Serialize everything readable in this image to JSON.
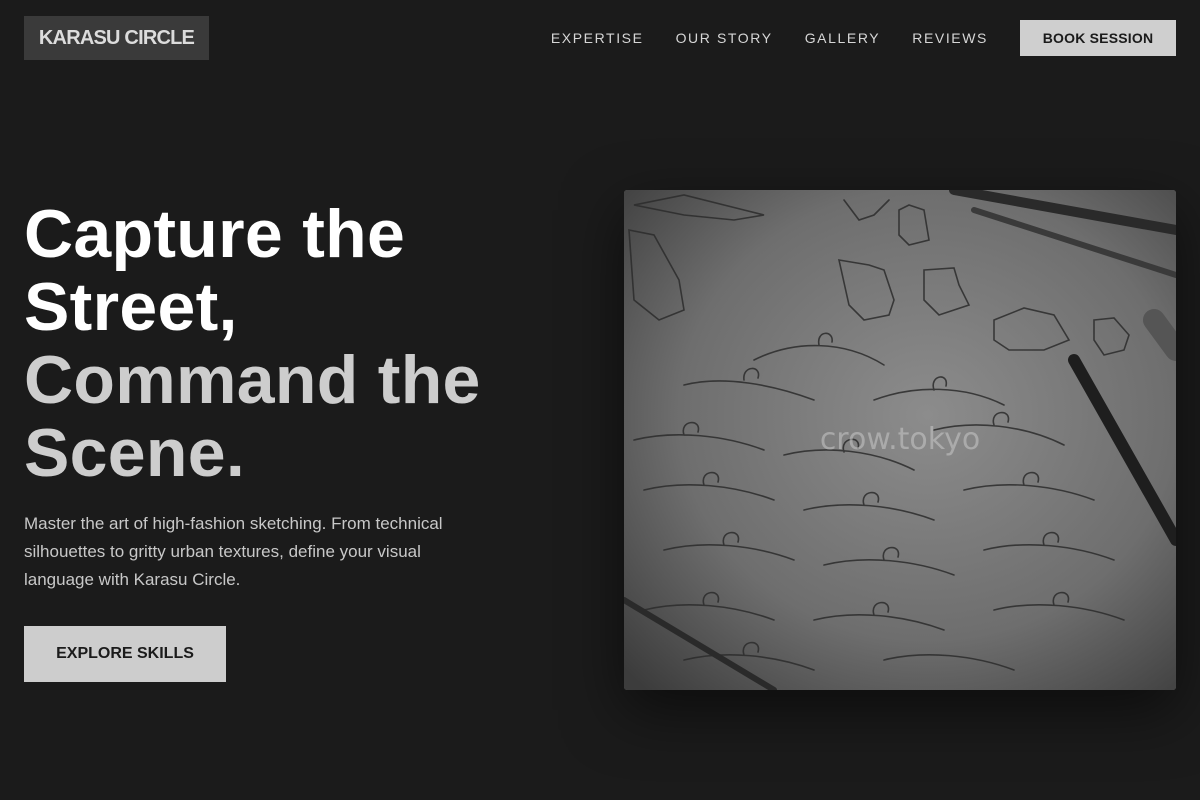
{
  "brand": {
    "name": "KARASU CIRCLE"
  },
  "nav": {
    "items": [
      {
        "label": "EXPERTISE"
      },
      {
        "label": "OUR STORY"
      },
      {
        "label": "GALLERY"
      },
      {
        "label": "REVIEWS"
      }
    ],
    "cta_label": "BOOK SESSION"
  },
  "hero": {
    "title_line1": "Capture the Street,",
    "title_line2": "Command the Scene.",
    "description": "Master the art of high-fashion sketching. From technical silhouettes to gritty urban textures, define your visual language with Karasu Circle.",
    "cta_label": "EXPLORE SKILLS"
  },
  "image": {
    "subject": "pencil fashion sketches of garments and hangers with pencils",
    "watermark": "crow.tokyo"
  },
  "colors": {
    "background": "#1b1b1b",
    "button": "#cfcfcf",
    "logo_bg": "#3a3a3a"
  }
}
